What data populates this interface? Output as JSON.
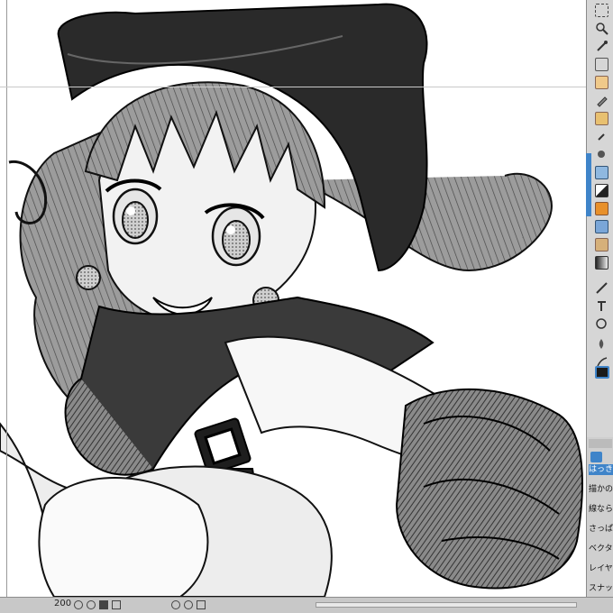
{
  "statusbar": {
    "zoom": "200"
  },
  "sub_panel": {
    "items": [
      "はっきり",
      "描かの下",
      "線ならず",
      "さっぱり",
      "ベクター",
      "レイヤー",
      "スナップ"
    ]
  },
  "colors": {
    "accent_blue": "#3f84c9",
    "accent_orange": "#e8902a"
  }
}
